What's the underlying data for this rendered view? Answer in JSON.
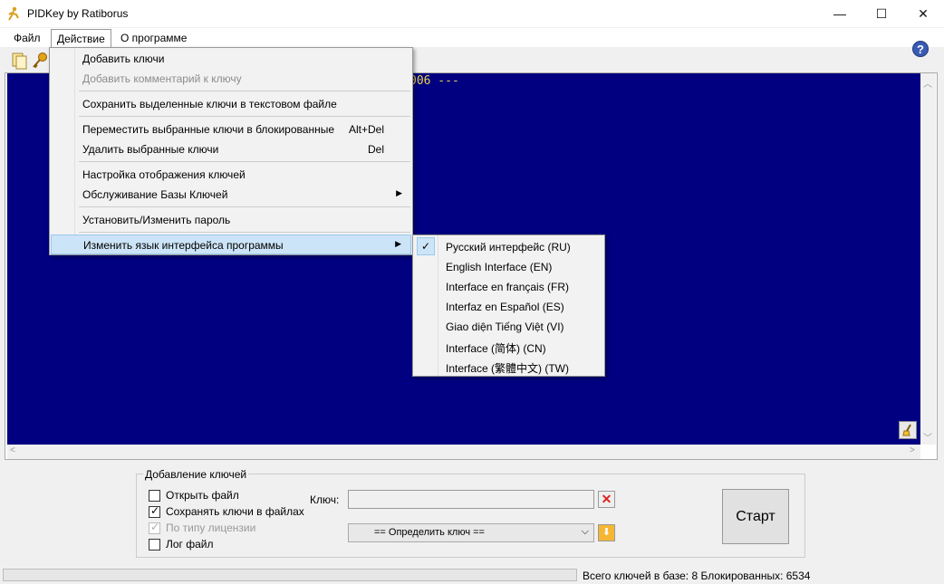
{
  "window": {
    "title": "PIDKey by Ratiborus",
    "minimize": "—",
    "maximize": "☐",
    "close": "✕"
  },
  "menubar": {
    "file": "Файл",
    "action": "Действие",
    "about": "О программе"
  },
  "console": {
    "text": "006 ---"
  },
  "action_menu": {
    "items": [
      {
        "label": "Добавить ключи",
        "shortcut": ""
      },
      {
        "label": "Добавить комментарий к ключу",
        "shortcut": ""
      },
      {
        "label": "Сохранить выделенные ключи в текстовом файле",
        "shortcut": ""
      },
      {
        "label": "Переместить выбранные ключи в блокированные",
        "shortcut": "Alt+Del"
      },
      {
        "label": "Удалить выбранные ключи",
        "shortcut": "Del"
      },
      {
        "label": "Настройка отображения ключей",
        "shortcut": ""
      },
      {
        "label": "Обслуживание Базы Ключей",
        "shortcut": ""
      },
      {
        "label": "Установить/Изменить пароль",
        "shortcut": ""
      },
      {
        "label": "Изменить язык интерфейса программы",
        "shortcut": ""
      }
    ]
  },
  "language_menu": {
    "items": [
      {
        "label": "Русский интерфейс (RU)",
        "checked": true
      },
      {
        "label": "English Interface (EN)",
        "checked": false
      },
      {
        "label": "Interface en français (FR)",
        "checked": false
      },
      {
        "label": "Interfaz en Español (ES)",
        "checked": false
      },
      {
        "label": "Giao diện Tiếng Việt (VI)",
        "checked": false
      },
      {
        "label": "Interface (简体) (CN)",
        "checked": false
      },
      {
        "label": "Interface (繁體中文) (TW)",
        "checked": false
      }
    ]
  },
  "add_keys": {
    "group_title": "Добавление ключей",
    "open_file": "Открыть файл",
    "save_keys": "Сохранять ключи в файлах",
    "by_license": "По типу лицензии",
    "log_file": "Лог файл",
    "key_label": "Ключ:",
    "key_value": "",
    "detect_select": "== Определить ключ ==",
    "start": "Старт"
  },
  "status": {
    "text": "Всего ключей в базе: 8  Блокированных: 6534"
  },
  "colors": {
    "console_bg": "#000080",
    "console_text": "#e8d44a",
    "menu_highlight": "#cce4f7"
  }
}
